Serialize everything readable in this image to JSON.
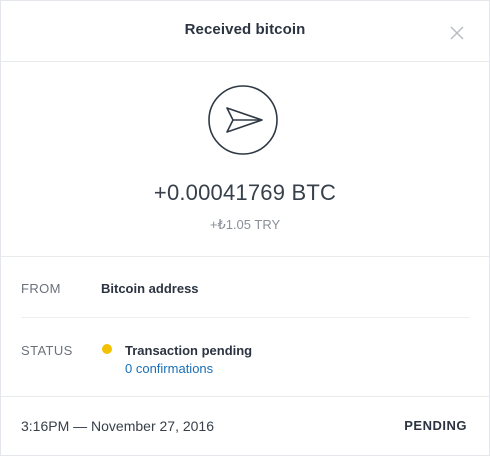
{
  "header": {
    "title": "Received bitcoin",
    "close_icon": "close-icon"
  },
  "hero": {
    "icon": "send-arrow-icon",
    "amount": "+0.00041769 BTC",
    "fiat": "+₺1.05 TRY"
  },
  "details": {
    "from_label": "FROM",
    "from_value": "Bitcoin address",
    "status_label": "STATUS",
    "status_value": "Transaction pending",
    "status_color": "#f2c100",
    "confirmations": "0 confirmations"
  },
  "footer": {
    "timestamp": "3:16PM — November 27, 2016",
    "status_badge": "PENDING"
  }
}
